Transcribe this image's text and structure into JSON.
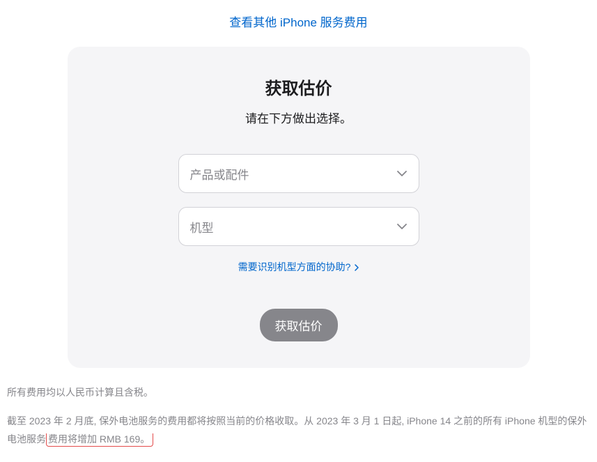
{
  "topLink": {
    "label": "查看其他 iPhone 服务费用"
  },
  "card": {
    "title": "获取估价",
    "subtitle": "请在下方做出选择。",
    "select1": {
      "placeholder": "产品或配件"
    },
    "select2": {
      "placeholder": "机型"
    },
    "helpLink": {
      "label": "需要识别机型方面的协助?"
    },
    "submit": {
      "label": "获取估价"
    }
  },
  "footnotes": {
    "note1": "所有费用均以人民币计算且含税。",
    "note2_part1": "截至 2023 年 2 月底, 保外电池服务的费用都将按照当前的价格收取。从 2023 年 3 月 1 日起, iPhone 14 之前的所有 iPhone 机型的保外电池服务",
    "note2_highlight": "费用将增加 RMB 169。"
  }
}
